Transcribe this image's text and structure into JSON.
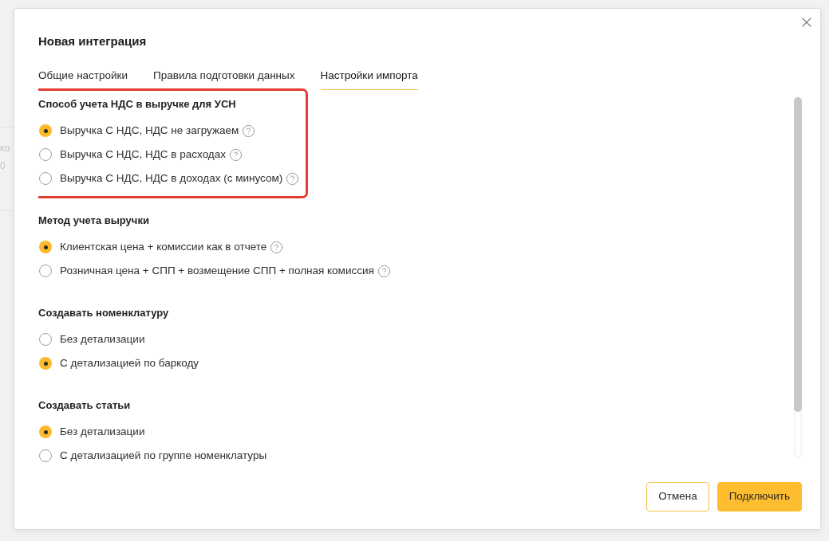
{
  "background_page": {
    "texts": [
      "ко",
      "0"
    ]
  },
  "dialog": {
    "title": "Новая интеграция",
    "tabs": [
      {
        "label": "Общие настройки",
        "selected": false
      },
      {
        "label": "Правила подготовки данных",
        "selected": false
      },
      {
        "label": "Настройки импорта",
        "selected": true
      }
    ],
    "sections": [
      {
        "heading": "Способ учета НДС в выручке для УСН",
        "highlighted": true,
        "options": [
          {
            "label": "Выручка С НДС, НДС не загружаем",
            "selected": true,
            "help": true
          },
          {
            "label": "Выручка С НДС, НДС в расходах",
            "selected": false,
            "help": true
          },
          {
            "label": "Выручка С НДС, НДС в доходах (с минусом)",
            "selected": false,
            "help": true
          }
        ]
      },
      {
        "heading": "Метод учета выручки",
        "highlighted": false,
        "options": [
          {
            "label": "Клиентская цена + комиссии как в отчете",
            "selected": true,
            "help": true
          },
          {
            "label": "Розничная цена + СПП + возмещение СПП + полная комиссия",
            "selected": false,
            "help": true
          }
        ]
      },
      {
        "heading": "Создавать номенклатуру",
        "highlighted": false,
        "options": [
          {
            "label": "Без детализации",
            "selected": false,
            "help": false
          },
          {
            "label": "С детализацией по баркоду",
            "selected": true,
            "help": false
          }
        ]
      },
      {
        "heading": "Создавать статьи",
        "highlighted": false,
        "options": [
          {
            "label": "Без детализации",
            "selected": true,
            "help": false
          },
          {
            "label": "С детализацией по группе номенклатуры",
            "selected": false,
            "help": false
          }
        ]
      }
    ],
    "buttons": [
      {
        "label": "Отмена",
        "kind": "secondary"
      },
      {
        "label": "Подключить",
        "kind": "primary"
      }
    ]
  }
}
